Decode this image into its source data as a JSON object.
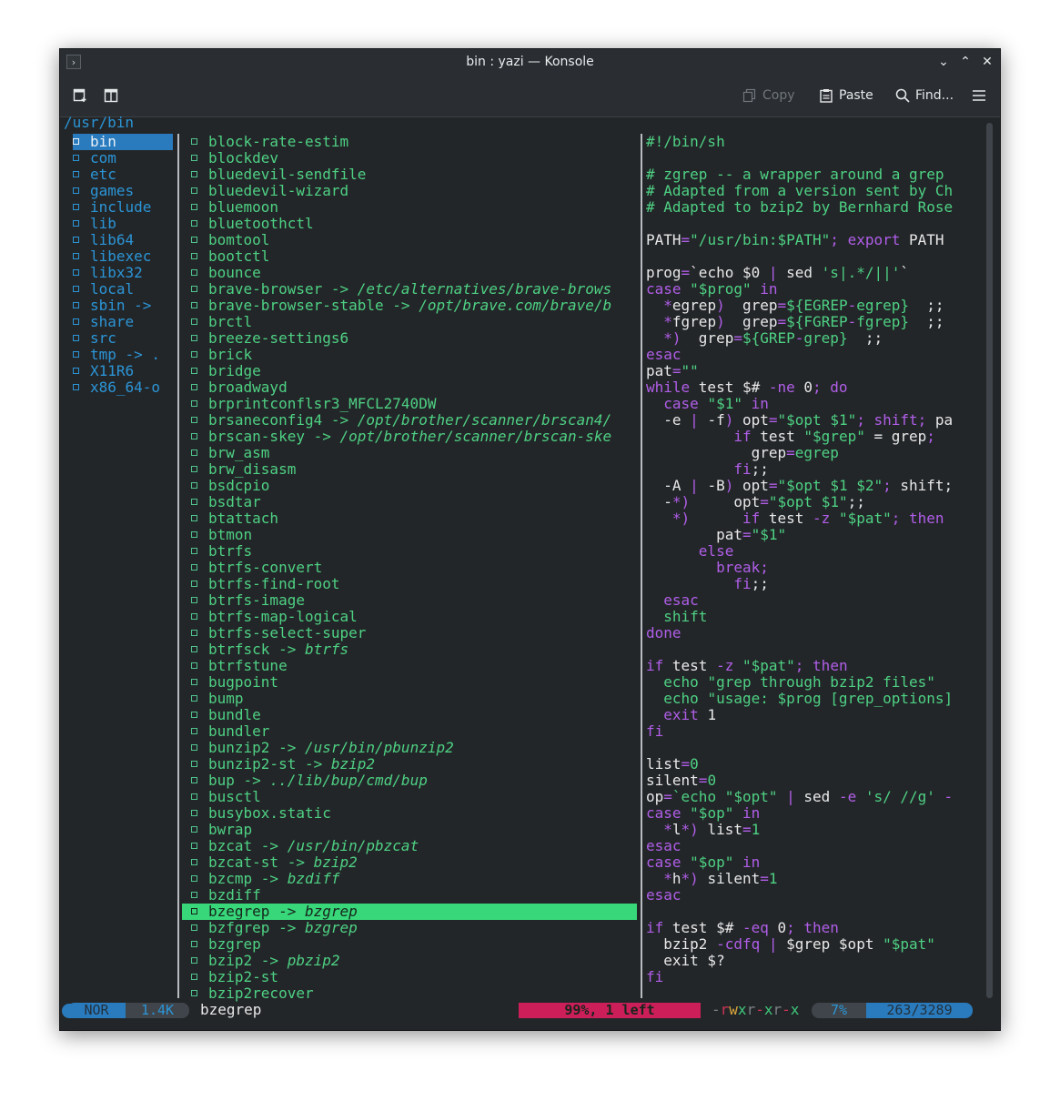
{
  "window": {
    "title": "bin : yazi — Konsole",
    "buttons": [
      "⌄",
      "⌃",
      "✕"
    ]
  },
  "toolbar": {
    "copy_label": "Copy",
    "paste_label": "Paste",
    "find_label": "Find..."
  },
  "path": "/usr/bin",
  "parent_list": [
    "bin",
    "com",
    "etc",
    "games",
    "include",
    "lib",
    "lib64",
    "libexec",
    "libx32",
    "local",
    "sbin ->",
    "share",
    "src",
    "tmp -> .",
    "X11R6",
    "x86_64-o"
  ],
  "current_list": [
    {
      "name": "block-rate-estim"
    },
    {
      "name": "blockdev"
    },
    {
      "name": "bluedevil-sendfile"
    },
    {
      "name": "bluedevil-wizard"
    },
    {
      "name": "bluemoon"
    },
    {
      "name": "bluetoothctl"
    },
    {
      "name": "bomtool"
    },
    {
      "name": "bootctl"
    },
    {
      "name": "bounce"
    },
    {
      "name": "brave-browser -> ",
      "target": "/etc/alternatives/brave-brows"
    },
    {
      "name": "brave-browser-stable -> ",
      "target": "/opt/brave.com/brave/b"
    },
    {
      "name": "brctl"
    },
    {
      "name": "breeze-settings6"
    },
    {
      "name": "brick"
    },
    {
      "name": "bridge"
    },
    {
      "name": "broadwayd"
    },
    {
      "name": "brprintconflsr3_MFCL2740DW"
    },
    {
      "name": "brsaneconfig4 -> ",
      "target": "/opt/brother/scanner/brscan4/"
    },
    {
      "name": "brscan-skey -> ",
      "target": "/opt/brother/scanner/brscan-ske"
    },
    {
      "name": "brw_asm"
    },
    {
      "name": "brw_disasm"
    },
    {
      "name": "bsdcpio"
    },
    {
      "name": "bsdtar"
    },
    {
      "name": "btattach"
    },
    {
      "name": "btmon"
    },
    {
      "name": "btrfs"
    },
    {
      "name": "btrfs-convert"
    },
    {
      "name": "btrfs-find-root"
    },
    {
      "name": "btrfs-image"
    },
    {
      "name": "btrfs-map-logical"
    },
    {
      "name": "btrfs-select-super"
    },
    {
      "name": "btrfsck -> ",
      "target": "btrfs"
    },
    {
      "name": "btrfstune"
    },
    {
      "name": "bugpoint"
    },
    {
      "name": "bump"
    },
    {
      "name": "bundle"
    },
    {
      "name": "bundler"
    },
    {
      "name": "bunzip2 -> ",
      "target": "/usr/bin/pbunzip2"
    },
    {
      "name": "bunzip2-st -> ",
      "target": "bzip2"
    },
    {
      "name": "bup -> ",
      "target": "../lib/bup/cmd/bup"
    },
    {
      "name": "busctl"
    },
    {
      "name": "busybox.static"
    },
    {
      "name": "bwrap"
    },
    {
      "name": "bzcat -> ",
      "target": "/usr/bin/pbzcat"
    },
    {
      "name": "bzcat-st -> ",
      "target": "bzip2"
    },
    {
      "name": "bzcmp -> ",
      "target": "bzdiff"
    },
    {
      "name": "bzdiff"
    },
    {
      "name": "bzegrep -> ",
      "target": "bzgrep",
      "selected": true
    },
    {
      "name": "bzfgrep -> ",
      "target": "bzgrep"
    },
    {
      "name": "bzgrep"
    },
    {
      "name": "bzip2 -> ",
      "target": "pbzip2"
    },
    {
      "name": "bzip2-st"
    },
    {
      "name": "bzip2recover"
    }
  ],
  "preview_lines": [
    [
      [
        "#!/bin/sh",
        "g"
      ]
    ],
    [],
    [
      [
        "# zgrep -- a wrapper around a grep",
        "g"
      ]
    ],
    [
      [
        "# Adapted from a version sent by Ch",
        "g"
      ]
    ],
    [
      [
        "# Adapted to bzip2 by Bernhard Rose",
        "g"
      ]
    ],
    [],
    [
      [
        "PATH",
        "w"
      ],
      [
        "=",
        "p"
      ],
      [
        "\"/usr/bin:$PATH\"",
        "g"
      ],
      [
        "; export ",
        "p"
      ],
      [
        "PATH",
        "w"
      ]
    ],
    [],
    [
      [
        "prog",
        "w"
      ],
      [
        "=",
        "p"
      ],
      [
        "`echo $0 ",
        "w"
      ],
      [
        "| ",
        "p"
      ],
      [
        "sed ",
        "w"
      ],
      [
        "'s|.*/||'",
        "g"
      ],
      [
        "`",
        "w"
      ]
    ],
    [
      [
        "case ",
        "p"
      ],
      [
        "\"$prog\" ",
        "g"
      ],
      [
        "in",
        "p"
      ]
    ],
    [
      [
        "  *",
        "p"
      ],
      [
        "egrep",
        "w"
      ],
      [
        ")  ",
        "p"
      ],
      [
        "grep",
        "w"
      ],
      [
        "=",
        "p"
      ],
      [
        "${EGREP",
        "g"
      ],
      [
        "-",
        "p"
      ],
      [
        "egrep}",
        "g"
      ],
      [
        "  ;;",
        "w"
      ]
    ],
    [
      [
        "  *",
        "p"
      ],
      [
        "fgrep",
        "w"
      ],
      [
        ")  ",
        "p"
      ],
      [
        "grep",
        "w"
      ],
      [
        "=",
        "p"
      ],
      [
        "${FGREP",
        "g"
      ],
      [
        "-",
        "p"
      ],
      [
        "fgrep}",
        "g"
      ],
      [
        "  ;;",
        "w"
      ]
    ],
    [
      [
        "  *)  ",
        "p"
      ],
      [
        "grep",
        "w"
      ],
      [
        "=",
        "p"
      ],
      [
        "${GREP",
        "g"
      ],
      [
        "-",
        "p"
      ],
      [
        "grep}",
        "g"
      ],
      [
        "  ;;",
        "w"
      ]
    ],
    [
      [
        "esac",
        "p"
      ]
    ],
    [
      [
        "pat",
        "w"
      ],
      [
        "=",
        "p"
      ],
      [
        "\"\"",
        "g"
      ]
    ],
    [
      [
        "while ",
        "p"
      ],
      [
        "test $# ",
        "w"
      ],
      [
        "-ne ",
        "p"
      ],
      [
        "0",
        "w"
      ],
      [
        "; do",
        "p"
      ]
    ],
    [
      [
        "  case ",
        "p"
      ],
      [
        "\"$1\" ",
        "g"
      ],
      [
        "in",
        "p"
      ]
    ],
    [
      [
        "  -e ",
        "w"
      ],
      [
        "| ",
        "p"
      ],
      [
        "-f",
        "w"
      ],
      [
        ") ",
        "p"
      ],
      [
        "opt",
        "w"
      ],
      [
        "=",
        "p"
      ],
      [
        "\"$opt $1\"",
        "g"
      ],
      [
        "; ",
        "p"
      ],
      [
        "shift",
        "p"
      ],
      [
        "; ",
        "p"
      ],
      [
        "pa",
        "w"
      ]
    ],
    [
      [
        "          if ",
        "p"
      ],
      [
        "test ",
        "w"
      ],
      [
        "\"$grep\" ",
        "g"
      ],
      [
        "= grep",
        "w"
      ],
      [
        ";",
        "p"
      ]
    ],
    [
      [
        "            grep",
        "w"
      ],
      [
        "=",
        "p"
      ],
      [
        "egrep",
        "g"
      ]
    ],
    [
      [
        "          fi",
        "p"
      ],
      [
        ";;",
        "w"
      ]
    ],
    [
      [
        "  -A ",
        "w"
      ],
      [
        "| ",
        "p"
      ],
      [
        "-B",
        "w"
      ],
      [
        ") ",
        "p"
      ],
      [
        "opt",
        "w"
      ],
      [
        "=",
        "p"
      ],
      [
        "\"$opt $1 $2\"",
        "g"
      ],
      [
        "; ",
        "p"
      ],
      [
        "shift",
        "w"
      ],
      [
        ";",
        "w"
      ]
    ],
    [
      [
        "  -",
        "w"
      ],
      [
        "*)     ",
        "p"
      ],
      [
        "opt",
        "w"
      ],
      [
        "=",
        "p"
      ],
      [
        "\"$opt $1\"",
        "g"
      ],
      [
        ";;",
        "w"
      ]
    ],
    [
      [
        "   *)      ",
        "p"
      ],
      [
        "if ",
        "p"
      ],
      [
        "test ",
        "w"
      ],
      [
        "-z ",
        "p"
      ],
      [
        "\"$pat\"",
        "g"
      ],
      [
        "; then",
        "p"
      ]
    ],
    [
      [
        "        pat",
        "w"
      ],
      [
        "=",
        "p"
      ],
      [
        "\"$1\"",
        "g"
      ]
    ],
    [
      [
        "      else",
        "p"
      ]
    ],
    [
      [
        "        break;",
        "p"
      ]
    ],
    [
      [
        "          fi",
        "p"
      ],
      [
        ";;",
        "w"
      ]
    ],
    [
      [
        "  esac",
        "p"
      ]
    ],
    [
      [
        "  shift",
        "g"
      ]
    ],
    [
      [
        "done",
        "p"
      ]
    ],
    [],
    [
      [
        "if ",
        "p"
      ],
      [
        "test ",
        "w"
      ],
      [
        "-z ",
        "p"
      ],
      [
        "\"$pat\"",
        "g"
      ],
      [
        "; then",
        "p"
      ]
    ],
    [
      [
        "  echo ",
        "g"
      ],
      [
        "\"grep through bzip2 files\"",
        "g"
      ]
    ],
    [
      [
        "  echo ",
        "g"
      ],
      [
        "\"usage: $prog [grep_options]",
        "g"
      ]
    ],
    [
      [
        "  exit ",
        "p"
      ],
      [
        "1",
        "w"
      ]
    ],
    [
      [
        "fi",
        "p"
      ]
    ],
    [],
    [
      [
        "list",
        "w"
      ],
      [
        "=",
        "p"
      ],
      [
        "0",
        "g"
      ]
    ],
    [
      [
        "silent",
        "w"
      ],
      [
        "=",
        "p"
      ],
      [
        "0",
        "g"
      ]
    ],
    [
      [
        "op",
        "w"
      ],
      [
        "=",
        "p"
      ],
      [
        "`echo ",
        "g"
      ],
      [
        "\"$opt\" ",
        "g"
      ],
      [
        "| ",
        "p"
      ],
      [
        "sed ",
        "w"
      ],
      [
        "-e ",
        "p"
      ],
      [
        "'s/ //g' ",
        "g"
      ],
      [
        "-",
        "p"
      ]
    ],
    [
      [
        "case ",
        "p"
      ],
      [
        "\"$op\" ",
        "g"
      ],
      [
        "in",
        "p"
      ]
    ],
    [
      [
        "  *",
        "p"
      ],
      [
        "l",
        "w"
      ],
      [
        "*) ",
        "p"
      ],
      [
        "list",
        "w"
      ],
      [
        "=",
        "p"
      ],
      [
        "1",
        "g"
      ]
    ],
    [
      [
        "esac",
        "p"
      ]
    ],
    [
      [
        "case ",
        "p"
      ],
      [
        "\"$op\" ",
        "g"
      ],
      [
        "in",
        "p"
      ]
    ],
    [
      [
        "  *",
        "p"
      ],
      [
        "h",
        "w"
      ],
      [
        "*) ",
        "p"
      ],
      [
        "silent",
        "w"
      ],
      [
        "=",
        "p"
      ],
      [
        "1",
        "g"
      ]
    ],
    [
      [
        "esac",
        "p"
      ]
    ],
    [],
    [
      [
        "if ",
        "p"
      ],
      [
        "test $# ",
        "w"
      ],
      [
        "-eq ",
        "p"
      ],
      [
        "0",
        "w"
      ],
      [
        "; then",
        "p"
      ]
    ],
    [
      [
        "  bzip2 ",
        "w"
      ],
      [
        "-cdfq ",
        "p"
      ],
      [
        "| ",
        "p"
      ],
      [
        "$grep $opt ",
        "w"
      ],
      [
        "\"$pat\"",
        "g"
      ]
    ],
    [
      [
        "  exit $?",
        "w"
      ]
    ],
    [
      [
        "fi",
        "p"
      ]
    ]
  ],
  "status": {
    "mode": "NOR",
    "size": "1.4K",
    "filename": "bzegrep",
    "progress": "99%, 1 left",
    "perms": [
      [
        "-",
        "d"
      ],
      [
        "r",
        "r"
      ],
      [
        "w",
        "y"
      ],
      [
        "x",
        "g"
      ],
      [
        "-",
        "d"
      ],
      [
        "x",
        "g"
      ],
      [
        "r",
        "r"
      ],
      [
        "-",
        "d"
      ],
      [
        "x",
        "g"
      ],
      [
        "r",
        "r"
      ],
      [
        "-",
        "d"
      ],
      [
        "x",
        "g"
      ]
    ],
    "perms_text": "-rwxr-xr-x",
    "percent": "7%",
    "position": "263/3289"
  },
  "colors": {
    "accent_blue": "#2a7bbd",
    "green": "#4ed183",
    "purple": "#b05ee8",
    "progress_red": "#cc1f59"
  }
}
